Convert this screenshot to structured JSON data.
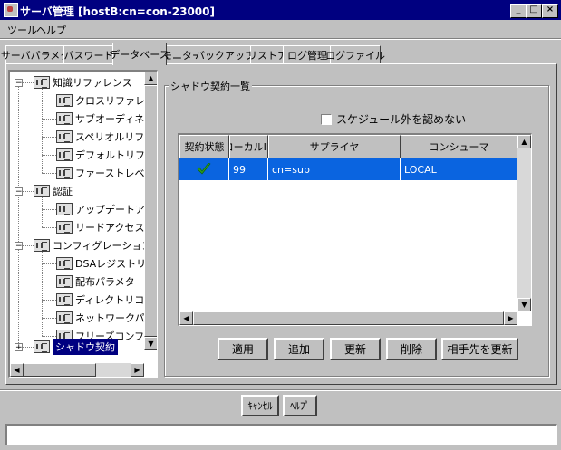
{
  "window": {
    "title": "サーバ管理 [hostB:cn=con-23000]",
    "controls": {
      "minimize": "_",
      "maximize": "□",
      "close": "×"
    }
  },
  "menu": {
    "items": [
      {
        "label": "ツール"
      },
      {
        "label": "ヘルプ"
      }
    ]
  },
  "tabs": [
    {
      "label": "サーバパラメタ",
      "active": false
    },
    {
      "label": "パスワード",
      "active": false
    },
    {
      "label": "データベース",
      "active": true
    },
    {
      "label": "モニター",
      "active": false
    },
    {
      "label": "バックアップ",
      "active": false
    },
    {
      "label": "リストア",
      "active": false
    },
    {
      "label": "ログ管理",
      "active": false
    },
    {
      "label": "ログファイル",
      "active": false
    }
  ],
  "tree": {
    "groups": [
      {
        "label": "知識リファレンス",
        "expanded": true,
        "children": [
          {
            "label": "クロスリファレンス"
          },
          {
            "label": "サブオーディネート"
          },
          {
            "label": "スペリオルリファレン"
          },
          {
            "label": "デフォルトリファレル"
          },
          {
            "label": "ファーストレベルリフ"
          }
        ]
      },
      {
        "label": "認証",
        "expanded": true,
        "children": [
          {
            "label": "アップデートアクセ"
          },
          {
            "label": "リードアクセス制限"
          }
        ]
      },
      {
        "label": "コンフィグレーション",
        "expanded": true,
        "children": [
          {
            "label": "DSAレジストリ"
          },
          {
            "label": "配布パラメタ"
          },
          {
            "label": "ディレクトリコンフィ"
          },
          {
            "label": "ネットワークパラメタ"
          },
          {
            "label": "フリーズコンフィグ"
          }
        ]
      },
      {
        "label": "シャドウ契約",
        "expanded": false,
        "selected": true,
        "children": []
      }
    ]
  },
  "shadow_panel": {
    "group_title": "シャドウ契約一覧",
    "checkbox_label": "スケジュール外を認めない",
    "checkbox_checked": false,
    "table": {
      "columns": [
        "契約状態",
        "ローカルID",
        "サプライヤ",
        "コンシューマ"
      ],
      "rows": [
        {
          "status_icon": "checkmark-icon",
          "local_id": "99",
          "supplier": "cn=sup",
          "consumer": "LOCAL",
          "selected": true
        }
      ]
    },
    "buttons": {
      "apply": "適用",
      "add": "追加",
      "update": "更新",
      "delete": "削除",
      "update_partner": "相手先を更新"
    }
  },
  "footer": {
    "cancel": "ｷｬﾝｾﾙ",
    "help": "ﾍﾙﾌﾟ"
  },
  "colors": {
    "titlebar": "#000080",
    "selection": "#0a64e0",
    "check": "#2a9a20"
  }
}
